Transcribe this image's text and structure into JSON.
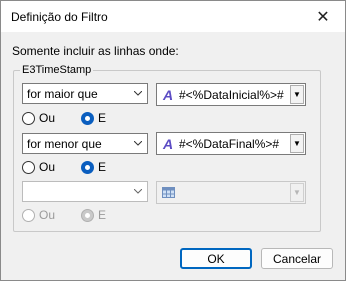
{
  "window": {
    "title": "Definição do Filtro"
  },
  "prompt": "Somente incluir as linhas onde:",
  "group_label": "E3TimeStamp",
  "rows": [
    {
      "condition": "for maior que",
      "expression": "#<%DataInicial%>#",
      "radio_or": "Ou",
      "radio_and": "E"
    },
    {
      "condition": "for menor que",
      "expression": "#<%DataFinal%>#",
      "radio_or": "Ou",
      "radio_and": "E"
    },
    {
      "condition": "",
      "expression": "",
      "radio_or": "Ou",
      "radio_and": "E"
    }
  ],
  "buttons": {
    "ok": "OK",
    "cancel": "Cancelar"
  },
  "colors": {
    "accent": "#0067c0",
    "expr_icon": "#5b4bc4"
  }
}
